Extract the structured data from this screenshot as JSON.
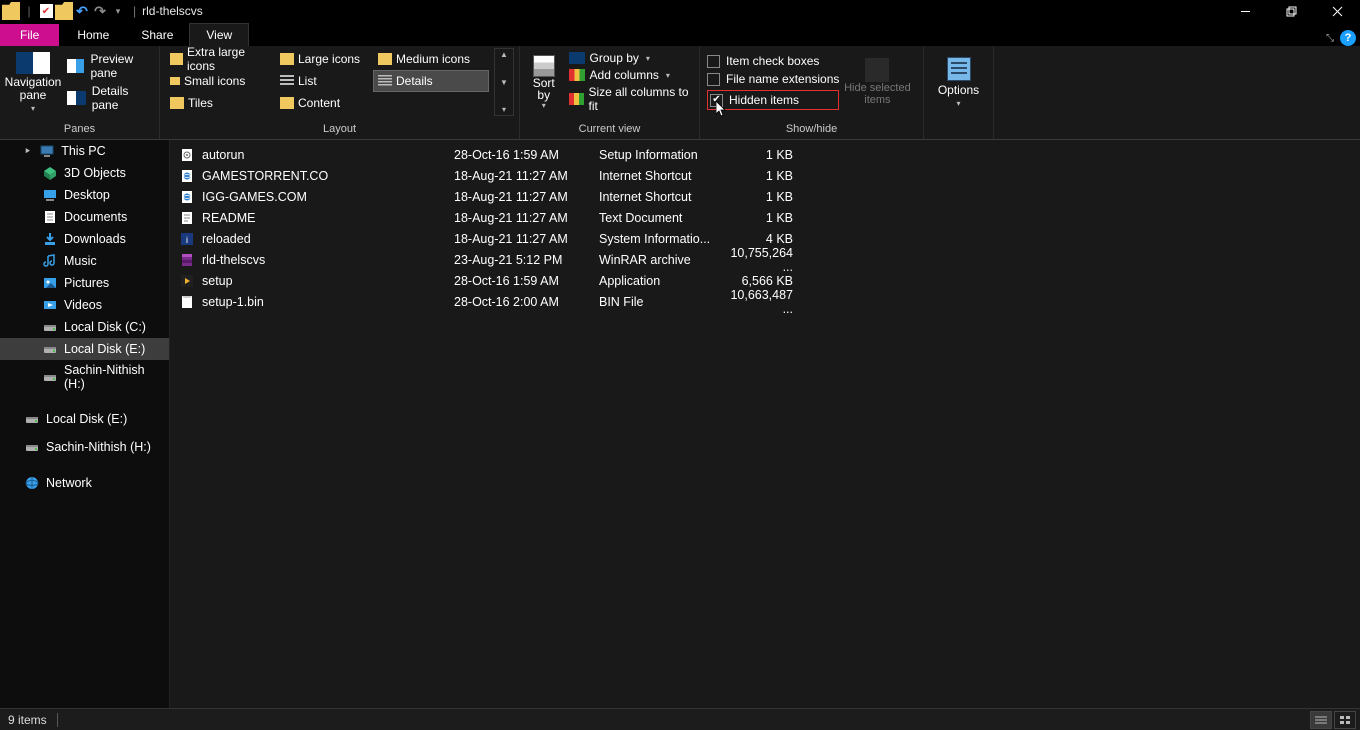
{
  "title": "rld-thelscvs",
  "tabs": {
    "file": "File",
    "home": "Home",
    "share": "Share",
    "view": "View"
  },
  "ribbon": {
    "panes": {
      "label": "Panes",
      "navigation_pane": "Navigation\npane",
      "preview_pane": "Preview pane",
      "details_pane": "Details pane"
    },
    "layout": {
      "label": "Layout",
      "options": {
        "extra_large": "Extra large icons",
        "large": "Large icons",
        "medium": "Medium icons",
        "small": "Small icons",
        "list": "List",
        "details": "Details",
        "tiles": "Tiles",
        "content": "Content"
      }
    },
    "current_view": {
      "label": "Current view",
      "sort_by": "Sort\nby",
      "group_by": "Group by",
      "add_columns": "Add columns",
      "size_all": "Size all columns to fit"
    },
    "show_hide": {
      "label": "Show/hide",
      "item_check": "Item check boxes",
      "file_ext": "File name extensions",
      "hidden": "Hidden items",
      "item_check_checked": false,
      "file_ext_checked": false,
      "hidden_checked": true,
      "hide_selected": "Hide selected\nitems"
    },
    "options": "Options"
  },
  "sidebar": [
    {
      "name": "This PC",
      "icon": "pc",
      "sel": false,
      "indent": 0
    },
    {
      "name": "3D Objects",
      "icon": "3d",
      "sel": false,
      "indent": 1
    },
    {
      "name": "Desktop",
      "icon": "desktop",
      "sel": false,
      "indent": 1
    },
    {
      "name": "Documents",
      "icon": "docs",
      "sel": false,
      "indent": 1
    },
    {
      "name": "Downloads",
      "icon": "downloads",
      "sel": false,
      "indent": 1
    },
    {
      "name": "Music",
      "icon": "music",
      "sel": false,
      "indent": 1
    },
    {
      "name": "Pictures",
      "icon": "pictures",
      "sel": false,
      "indent": 1
    },
    {
      "name": "Videos",
      "icon": "videos",
      "sel": false,
      "indent": 1
    },
    {
      "name": "Local Disk (C:)",
      "icon": "drive",
      "sel": false,
      "indent": 1
    },
    {
      "name": "Local Disk (E:)",
      "icon": "drive",
      "sel": true,
      "indent": 1
    },
    {
      "name": "Sachin-Nithish (H:)",
      "icon": "drive",
      "sel": false,
      "indent": 2
    },
    {
      "spacer": true
    },
    {
      "name": "Local Disk (E:)",
      "icon": "drive",
      "sel": false,
      "indent": 0
    },
    {
      "spacer_sm": true
    },
    {
      "name": "Sachin-Nithish (H:)",
      "icon": "drive",
      "sel": false,
      "indent": 0
    },
    {
      "spacer": true
    },
    {
      "name": "Network",
      "icon": "network",
      "sel": false,
      "indent": 0
    }
  ],
  "files": [
    {
      "name": "autorun",
      "date": "28-Oct-16 1:59 AM",
      "type": "Setup Information",
      "size": "1 KB",
      "icon": "inf"
    },
    {
      "name": "GAMESTORRENT.CO",
      "date": "18-Aug-21 11:27 AM",
      "type": "Internet Shortcut",
      "size": "1 KB",
      "icon": "url"
    },
    {
      "name": "IGG-GAMES.COM",
      "date": "18-Aug-21 11:27 AM",
      "type": "Internet Shortcut",
      "size": "1 KB",
      "icon": "url"
    },
    {
      "name": "README",
      "date": "18-Aug-21 11:27 AM",
      "type": "Text Document",
      "size": "1 KB",
      "icon": "txt"
    },
    {
      "name": "reloaded",
      "date": "18-Aug-21 11:27 AM",
      "type": "System Informatio...",
      "size": "4 KB",
      "icon": "nfo"
    },
    {
      "name": "rld-thelscvs",
      "date": "23-Aug-21 5:12 PM",
      "type": "WinRAR archive",
      "size": "10,755,264 ...",
      "icon": "rar"
    },
    {
      "name": "setup",
      "date": "28-Oct-16 1:59 AM",
      "type": "Application",
      "size": "6,566 KB",
      "icon": "exe"
    },
    {
      "name": "setup-1.bin",
      "date": "28-Oct-16 2:00 AM",
      "type": "BIN File",
      "size": "10,663,487 ...",
      "icon": "bin"
    }
  ],
  "status": {
    "items": "9 items"
  }
}
